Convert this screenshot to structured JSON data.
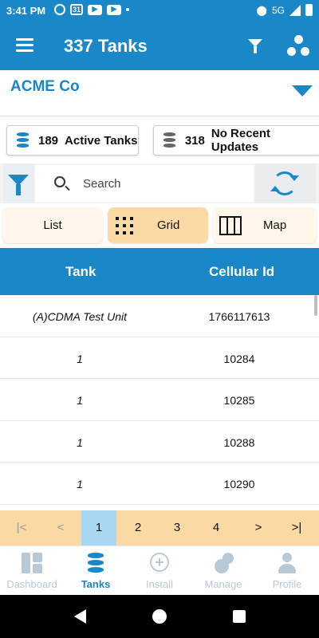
{
  "status_bar": {
    "time": "3:41 PM",
    "calendar_day": "31",
    "network": "5G"
  },
  "app_bar": {
    "title": "337 Tanks"
  },
  "company": {
    "name": "ACME Co"
  },
  "stats": {
    "active": {
      "count": "189",
      "label": "Active Tanks",
      "icon": "database-icon",
      "icon_color": "#1a87c9"
    },
    "no_updates": {
      "count": "318",
      "label": "No Recent Updates",
      "icon": "database-icon",
      "icon_color": "#666666"
    }
  },
  "search": {
    "placeholder": "Search",
    "value": ""
  },
  "view_tabs": {
    "list": "List",
    "grid": "Grid",
    "map": "Map",
    "selected": "Grid"
  },
  "table": {
    "headers": {
      "tank": "Tank",
      "cellular_id": "Cellular Id"
    },
    "rows": [
      {
        "tank": "(A)CDMA Test Unit",
        "cellular_id": "1766117613"
      },
      {
        "tank": "1",
        "cellular_id": "10284"
      },
      {
        "tank": "1",
        "cellular_id": "10285"
      },
      {
        "tank": "1",
        "cellular_id": "10288"
      },
      {
        "tank": "1",
        "cellular_id": "10290"
      }
    ]
  },
  "pagination": {
    "first": "|<",
    "prev": "<",
    "pages": [
      "1",
      "2",
      "3",
      "4"
    ],
    "current": "1",
    "next": ">",
    "last": ">|"
  },
  "bottom_nav": {
    "dashboard": "Dashboard",
    "tanks": "Tanks",
    "install": "Install",
    "manage": "Manage",
    "profile": "Profile",
    "active": "Tanks"
  },
  "colors": {
    "primary": "#1a87c9",
    "accent": "#fbd9a4",
    "active_page": "#a9d7f2",
    "inactive_nav": "#b7c9d6"
  }
}
